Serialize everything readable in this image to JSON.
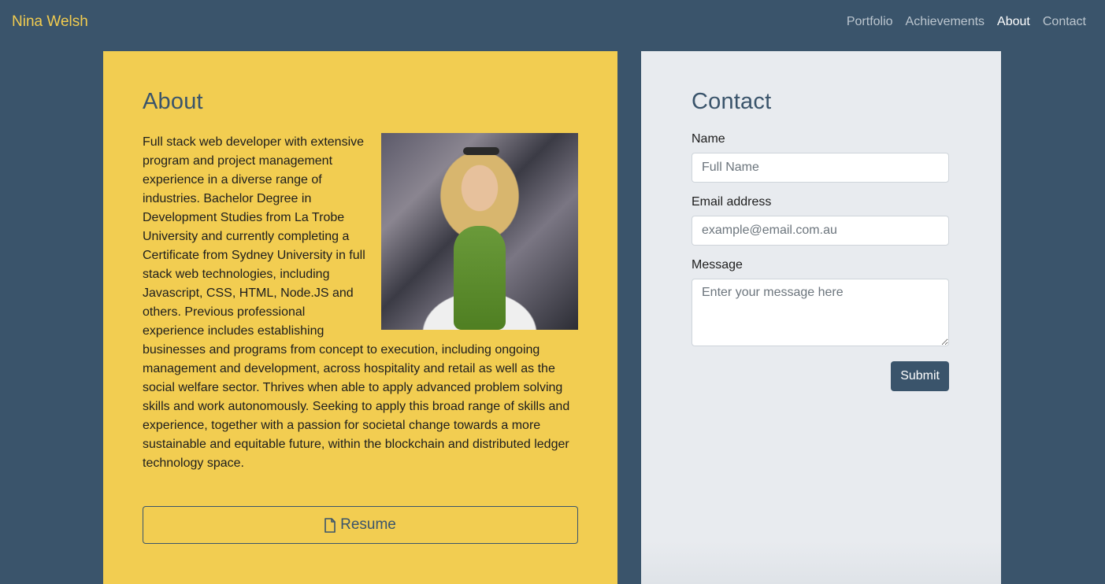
{
  "navbar": {
    "brand": "Nina Welsh",
    "links": [
      {
        "label": "Portfolio",
        "active": false
      },
      {
        "label": "Achievements",
        "active": false
      },
      {
        "label": "About",
        "active": true
      },
      {
        "label": "Contact",
        "active": false
      }
    ]
  },
  "about": {
    "title": "About",
    "paragraph": "Full stack web developer with extensive program and project management experience in a diverse range of industries. Bachelor Degree in Development Studies from La Trobe University and currently completing a Certificate from Sydney University in full stack web technologies, including Javascript, CSS, HTML, Node.JS and others. Previous professional experience includes establishing businesses and programs from concept to execution, including ongoing management and development, across hospitality and retail as well as the social welfare sector. Thrives when able to apply advanced problem solving skills and work autonomously. Seeking to apply this broad range of skills and experience, together with a passion for societal change towards a more sustainable and equitable future, within the blockchain and distributed ledger technology space.",
    "resume_label": "Resume",
    "resume_icon": "file-icon"
  },
  "contact": {
    "title": "Contact",
    "name_label": "Name",
    "name_placeholder": "Full Name",
    "name_value": "",
    "email_label": "Email address",
    "email_placeholder": "example@email.com.au",
    "email_value": "",
    "message_label": "Message",
    "message_placeholder": "Enter your message here",
    "message_value": "",
    "submit_label": "Submit"
  },
  "colors": {
    "background": "#3a546b",
    "brand": "#f2cc4f",
    "about_card": "#f2cd51",
    "contact_card": "#e8ebef",
    "button": "#3a546b"
  }
}
